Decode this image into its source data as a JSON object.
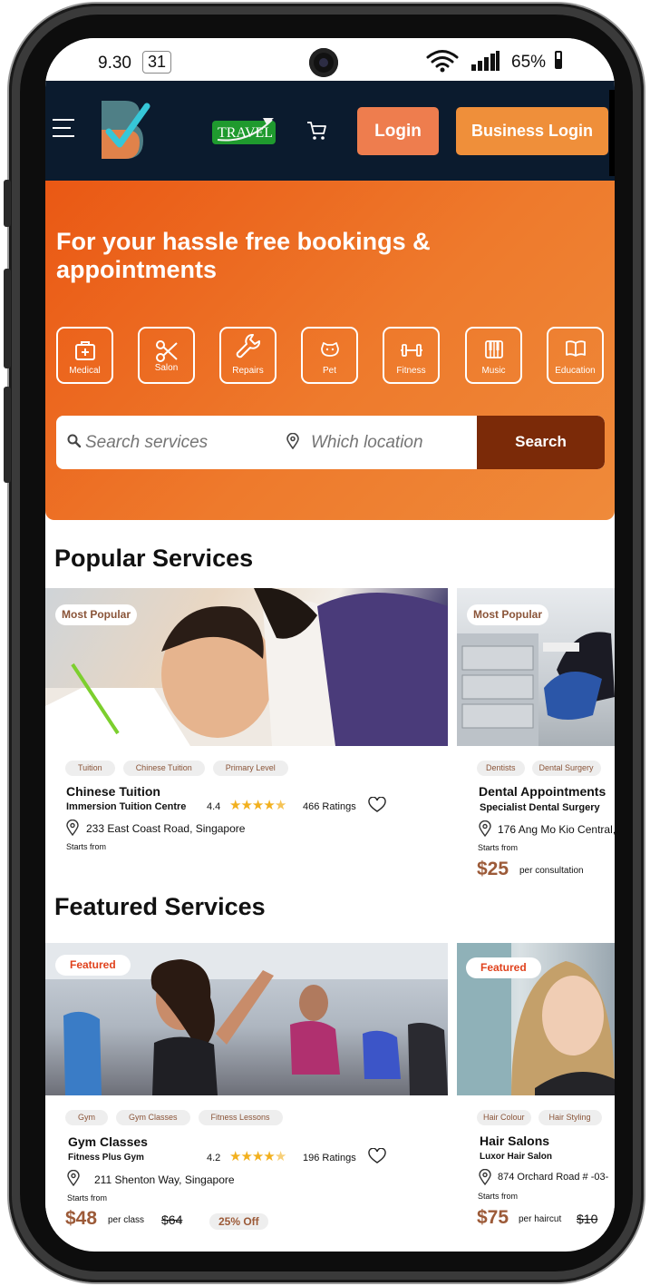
{
  "status_bar": {
    "time": "9.30",
    "calendar_date": "31",
    "battery": "65%"
  },
  "header": {
    "logo_letter": "B",
    "travel_label": "TRAVEL",
    "login_label": "Login",
    "business_login_label": "Business Login"
  },
  "hero": {
    "headline": "For your hassle free bookings & appointments",
    "categories": [
      {
        "label": "Medical",
        "icon": "medical-kit-icon"
      },
      {
        "label": "Salon",
        "icon": "scissors-icon"
      },
      {
        "label": "Repairs",
        "icon": "wrench-icon"
      },
      {
        "label": "Pet",
        "icon": "pet-icon"
      },
      {
        "label": "Fitness",
        "icon": "dumbbell-icon"
      },
      {
        "label": "Music",
        "icon": "piano-icon"
      },
      {
        "label": "Education",
        "icon": "book-icon"
      }
    ],
    "search": {
      "service_placeholder": "Search services",
      "location_placeholder": "Which location",
      "button_label": "Search"
    }
  },
  "popular": {
    "title": "Popular Services",
    "cards": [
      {
        "badge": "Most Popular",
        "tags": [
          "Tuition",
          "Chinese Tuition",
          "Primary Level"
        ],
        "title": "Chinese Tuition",
        "vendor": "Immersion Tuition Centre",
        "rating": "4.4",
        "rating_value": 4.4,
        "ratings_count": "466 Ratings",
        "address": "233 East Coast Road, Singapore",
        "starts_from": "Starts from"
      },
      {
        "badge": "Most Popular",
        "tags": [
          "Dentists",
          "Dental Surgery"
        ],
        "title": "Dental Appointments",
        "vendor": "Specialist Dental Surgery",
        "address": "176 Ang Mo Kio Central,",
        "starts_from": "Starts from",
        "price": "$25",
        "per": "per consultation"
      }
    ]
  },
  "featured": {
    "title": "Featured Services",
    "cards": [
      {
        "badge": "Featured",
        "tags": [
          "Gym",
          "Gym Classes",
          "Fitness Lessons"
        ],
        "title": "Gym Classes",
        "vendor": "Fitness Plus Gym",
        "rating": "4.2",
        "rating_value": 4.2,
        "ratings_count": "196 Ratings",
        "address": "211 Shenton Way, Singapore",
        "starts_from": "Starts from",
        "price": "$48",
        "per": "per class",
        "old_price": "$64",
        "discount": "25% Off"
      },
      {
        "badge": "Featured",
        "tags": [
          "Hair Colour",
          "Hair Styling"
        ],
        "title": "Hair Salons",
        "vendor": "Luxor Hair Salon",
        "address": "874 Orchard Road # -03-",
        "starts_from": "Starts from",
        "price": "$75",
        "per": "per haircut",
        "old_price": "$10"
      }
    ]
  },
  "colors": {
    "header_bg": "#0b1b2e",
    "hero_orange": "#ea5814",
    "login_btn": "#ee7d4e",
    "business_btn": "#ef8f3a",
    "search_btn": "#7b2a08",
    "price": "#9c5a38",
    "star": "#f2b01e"
  }
}
